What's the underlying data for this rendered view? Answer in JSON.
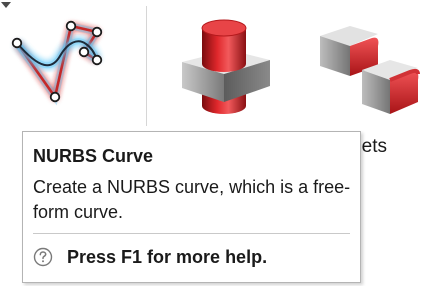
{
  "ribbon": {
    "tools": [
      {
        "name": "NURBS Curve",
        "icon": "nurbs-curve-icon",
        "has_dropdown": true
      },
      {
        "name": "Boss",
        "icon": "boss-extrude-icon"
      },
      {
        "name": "Fillets",
        "icon": "fillets-icon",
        "visible_label": "illets"
      }
    ]
  },
  "tooltip": {
    "title": "NURBS Curve",
    "description": "Create a NURBS curve, which is a free-form curve.",
    "help_text": "Press F1 for more help.",
    "help_icon": "question-circle-icon"
  },
  "colors": {
    "curve_glow": "#4fc3f7",
    "control_polygon": "#d32f2f",
    "control_point": "#ffffff",
    "solid_red": "#d8262a",
    "solid_gray": "#9e9e9e"
  }
}
